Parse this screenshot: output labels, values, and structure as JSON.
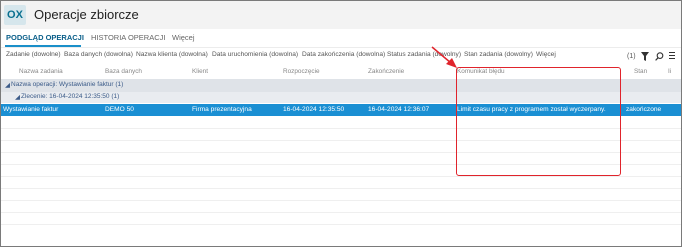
{
  "app": {
    "logo": "OX",
    "title": "Operacje zbiorcze"
  },
  "tabs": [
    {
      "label": "PODGLĄD OPERACJI",
      "active": true
    },
    {
      "label": "HISTORIA OPERACJI",
      "active": false
    },
    {
      "label": "Więcej",
      "active": false
    }
  ],
  "filters": [
    "Zadanie (dowolne)",
    "Baza danych (dowolna)",
    "Nazwa klienta (dowolna)",
    "Data uruchomienia (dowolna)",
    "Data zakończenia (dowolna)",
    "Status zadania (dowolny)",
    "Stan zadania (dowolny)",
    "Więcej"
  ],
  "toolbar": {
    "count": "(1)",
    "icons": [
      "filter-icon",
      "search-icon",
      "more-icon"
    ]
  },
  "columns": [
    "Nazwa zadania",
    "Baza danych",
    "Klient",
    "Rozpoczęcie",
    "Zakończenie",
    "Komunikat błędu",
    "Stan",
    "Ii"
  ],
  "groups": {
    "operation": "Nazwa operacji: Wystawianie faktur (1)",
    "order": "Zlecenie: 16-04-2024 12:35:50 (1)"
  },
  "row": {
    "task": "Wystawianie faktur",
    "database": "DEMO 50",
    "client": "Firma prezentacyjna",
    "start": "16-04-2024 12:35:50",
    "end": "16-04-2024 12:36:07",
    "error": "Limit czasu pracy z programem został wyczerpany.",
    "state": "zakończone"
  },
  "colors": {
    "accent": "#1a8fd3",
    "highlight": "#e0242c"
  }
}
